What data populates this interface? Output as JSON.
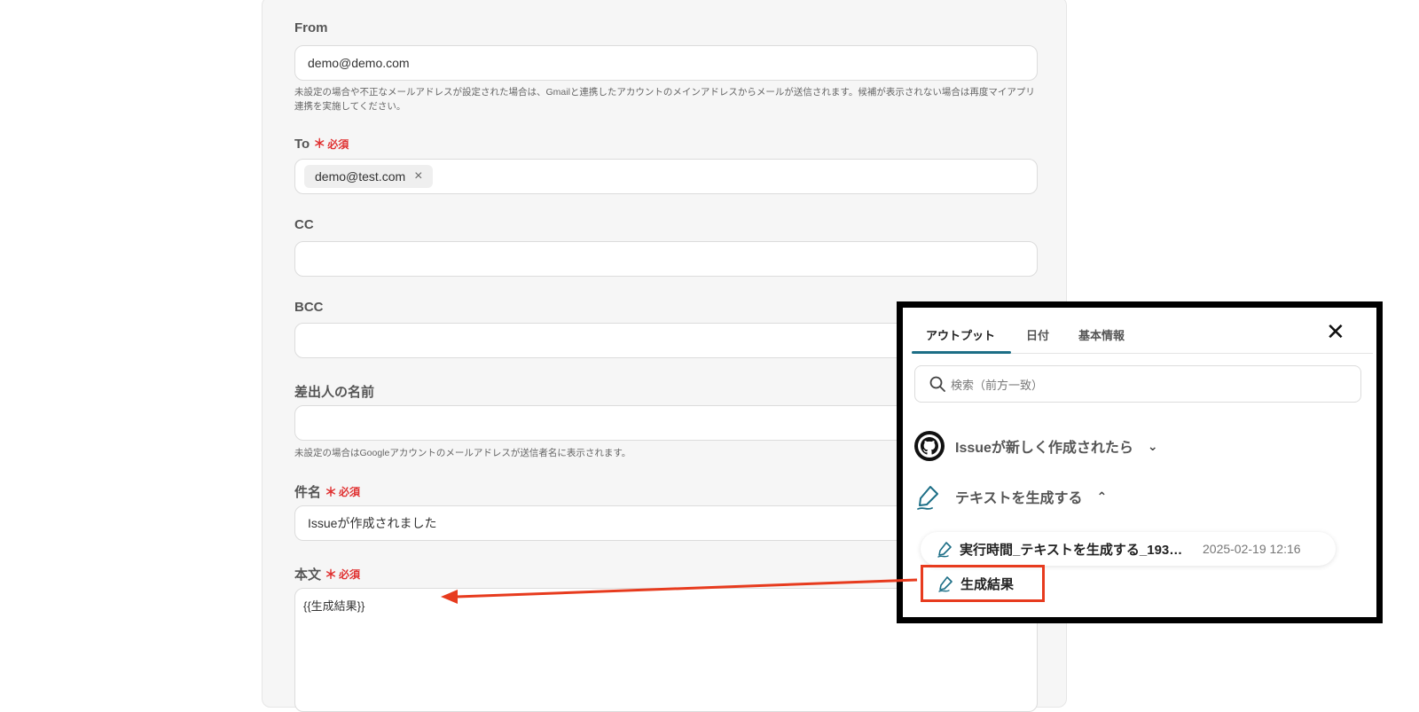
{
  "form": {
    "from": {
      "label": "From",
      "value": "demo@demo.com",
      "help": "未設定の場合や不正なメールアドレスが設定された場合は、Gmailと連携したアカウントのメインアドレスからメールが送信されます。候補が表示されない場合は再度マイアプリ連携を実施してください。"
    },
    "to": {
      "label": "To",
      "required": "必須",
      "chip": "demo@test.com"
    },
    "cc": {
      "label": "CC",
      "value": ""
    },
    "bcc": {
      "label": "BCC",
      "value": ""
    },
    "sender_name": {
      "label": "差出人の名前",
      "value": "",
      "help": "未設定の場合はGoogleアカウントのメールアドレスが送信者名に表示されます。"
    },
    "subject": {
      "label": "件名",
      "required": "必須",
      "value": "Issueが作成されました"
    },
    "body": {
      "label": "本文",
      "required": "必須",
      "value": "{{生成結果}}"
    }
  },
  "popup": {
    "tabs": [
      {
        "label": "アウトプット",
        "active": true
      },
      {
        "label": "日付",
        "active": false
      },
      {
        "label": "基本情報",
        "active": false
      }
    ],
    "search_placeholder": "検索（前方一致）",
    "groups": [
      {
        "label": "Issueが新しく作成されたら",
        "icon": "github-icon",
        "expanded": false
      },
      {
        "label": "テキストを生成する",
        "icon": "pen-icon",
        "expanded": true
      }
    ],
    "items": [
      {
        "label": "実行時間_テキストを生成する_193…",
        "date": "2025-02-19 12:16"
      },
      {
        "label": "生成結果"
      }
    ]
  },
  "colors": {
    "accent": "#1c6e86",
    "required": "#e03131",
    "highlight": "#e73b1e"
  }
}
